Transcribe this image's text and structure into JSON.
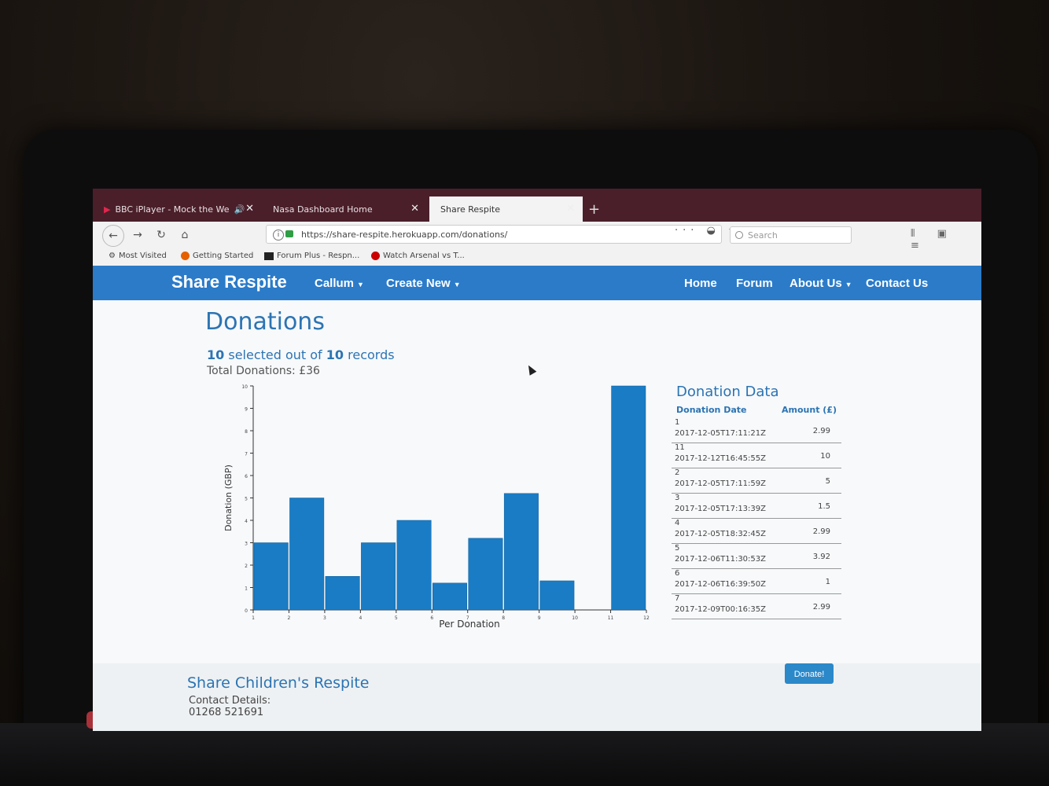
{
  "browser": {
    "tabs": [
      {
        "label": "BBC iPlayer - Mock the We"
      },
      {
        "label": "Nasa Dashboard Home"
      },
      {
        "label": "Share Respite"
      }
    ],
    "url": "https://share-respite.herokuapp.com/donations/",
    "search_placeholder": "Search",
    "bookmarks": [
      {
        "label": "Most Visited",
        "icon": "gear-icon",
        "color": "#555555"
      },
      {
        "label": "Getting Started",
        "icon": "firefox-icon",
        "color": "#e66000"
      },
      {
        "label": "Forum Plus - Respn...",
        "icon": "forum-icon",
        "color": "#222222"
      },
      {
        "label": "Watch Arsenal vs T...",
        "icon": "arsenal-icon",
        "color": "#cc0000"
      }
    ]
  },
  "site": {
    "brand": "Share Respite",
    "nav_left": [
      {
        "label": "Callum"
      },
      {
        "label": "Create New"
      }
    ],
    "nav_right": [
      {
        "label": "Home"
      },
      {
        "label": "Forum"
      },
      {
        "label": "About Us"
      },
      {
        "label": "Contact Us"
      }
    ],
    "accent": "#2b7bc9"
  },
  "page": {
    "title": "Donations",
    "selected_num": "10",
    "selected_mid": " selected out of ",
    "selected_total": "10",
    "selected_tail": " records",
    "total_donations": "Total Donations: £36"
  },
  "chart_data": {
    "type": "bar",
    "categories": [
      "1",
      "2",
      "3",
      "4",
      "5",
      "6",
      "7",
      "8",
      "9",
      "10",
      "11",
      "12"
    ],
    "values": [
      3,
      5,
      1.5,
      3,
      4,
      1.2,
      3.2,
      5.2,
      1.3,
      0,
      10,
      null
    ],
    "xlabel": "Per Donation",
    "ylabel": "Donation (GBP)",
    "ylim": [
      0,
      10
    ],
    "yticks": [
      "0",
      "1",
      "2",
      "3",
      "4",
      "5",
      "6",
      "7",
      "8",
      "9",
      "10"
    ],
    "color": "#1a7cc4"
  },
  "donation_data": {
    "title": "Donation Data",
    "col_date": "Donation Date",
    "col_amount": "Amount (£)",
    "rows": [
      {
        "id": "1",
        "date": "2017-12-05T17:11:21Z",
        "amount": "2.99"
      },
      {
        "id": "11",
        "date": "2017-12-12T16:45:55Z",
        "amount": "10"
      },
      {
        "id": "2",
        "date": "2017-12-05T17:11:59Z",
        "amount": "5"
      },
      {
        "id": "3",
        "date": "2017-12-05T17:13:39Z",
        "amount": "1.5"
      },
      {
        "id": "4",
        "date": "2017-12-05T18:32:45Z",
        "amount": "2.99"
      },
      {
        "id": "5",
        "date": "2017-12-06T11:30:53Z",
        "amount": "3.92"
      },
      {
        "id": "6",
        "date": "2017-12-06T16:39:50Z",
        "amount": "1"
      },
      {
        "id": "7",
        "date": "2017-12-09T00:16:35Z",
        "amount": "2.99"
      }
    ]
  },
  "footer": {
    "title": "Share Children's Respite",
    "contact_label": "Contact Details:",
    "phone": "01268 521691",
    "donate_label": "Donate!"
  }
}
